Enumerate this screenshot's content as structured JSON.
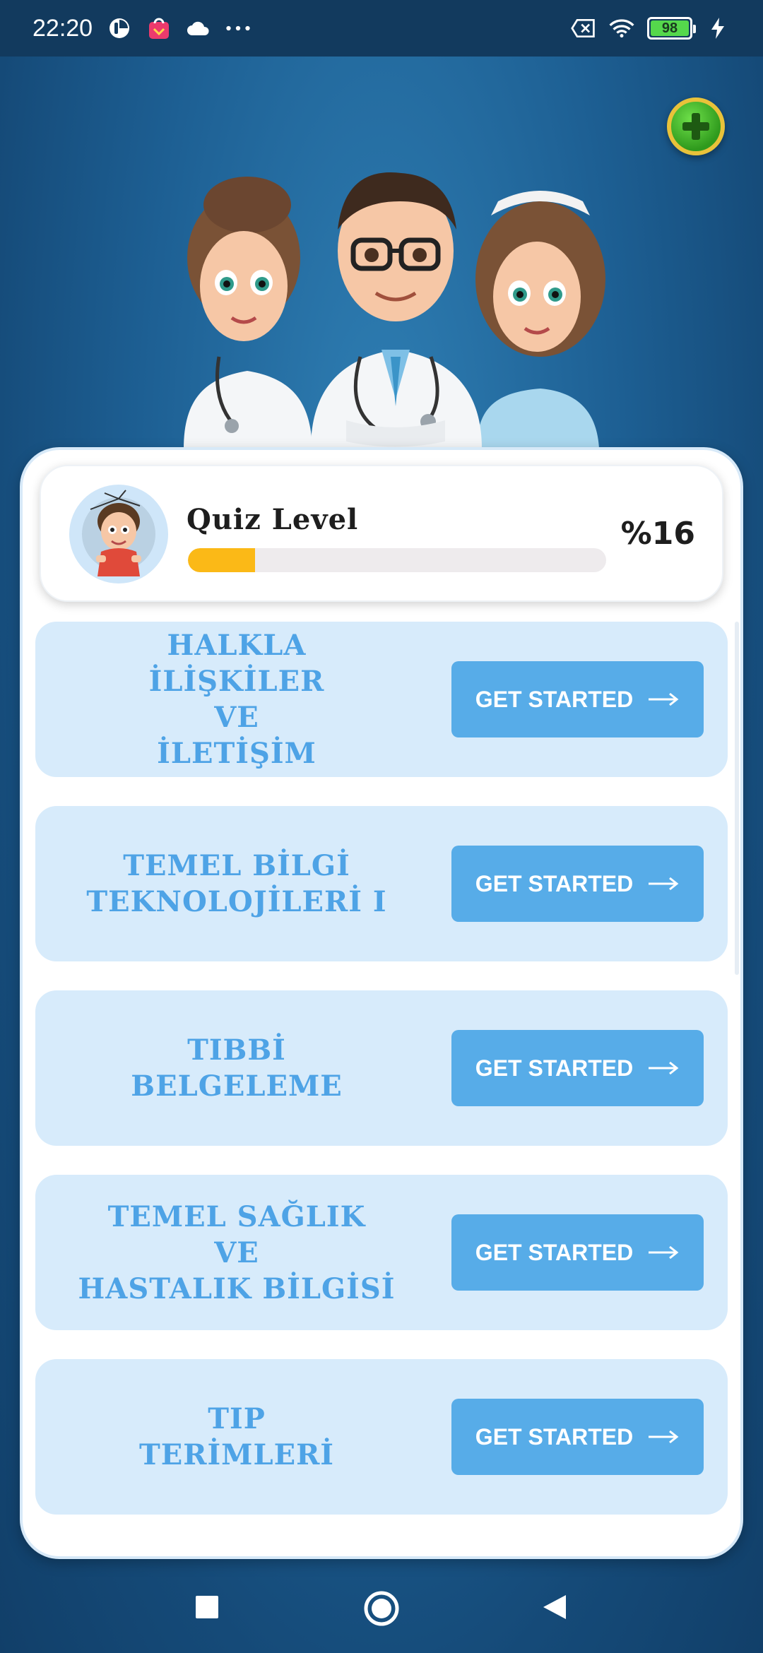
{
  "status_bar": {
    "time": "22:20",
    "battery_level": "98",
    "icons_left": [
      "timer-icon",
      "shopping-bag-icon",
      "cloud-icon",
      "more-dots-icon"
    ],
    "icons_right": [
      "no-sim-icon",
      "wifi-icon",
      "battery-icon",
      "charging-icon"
    ]
  },
  "level": {
    "title": "Quiz Level",
    "percent_text": "%16",
    "progress": 0.16,
    "bar_color": "#fbb917"
  },
  "courses": [
    {
      "title": "HALKLA İLİŞKİLER\nVE\nİLETİŞİM",
      "button_label": "GET STARTED"
    },
    {
      "title": "TEMEL BİLGİ\nTEKNOLOJİLERİ I",
      "button_label": "GET STARTED"
    },
    {
      "title": "TIBBİ\nBELGELEME",
      "button_label": "GET STARTED"
    },
    {
      "title": "TEMEL SAĞLIK\nVE\nHASTALIK BİLGİSİ",
      "button_label": "GET STARTED"
    },
    {
      "title": "TIP\nTERİMLERİ",
      "button_label": "GET STARTED"
    }
  ],
  "colors": {
    "course_card_bg": "#d7ebfb",
    "course_title": "#4ea3e6",
    "button_bg": "#57ace8",
    "background": "#1d5f93"
  },
  "nav": [
    "recents-square-icon",
    "home-circle-icon",
    "back-triangle-icon"
  ]
}
